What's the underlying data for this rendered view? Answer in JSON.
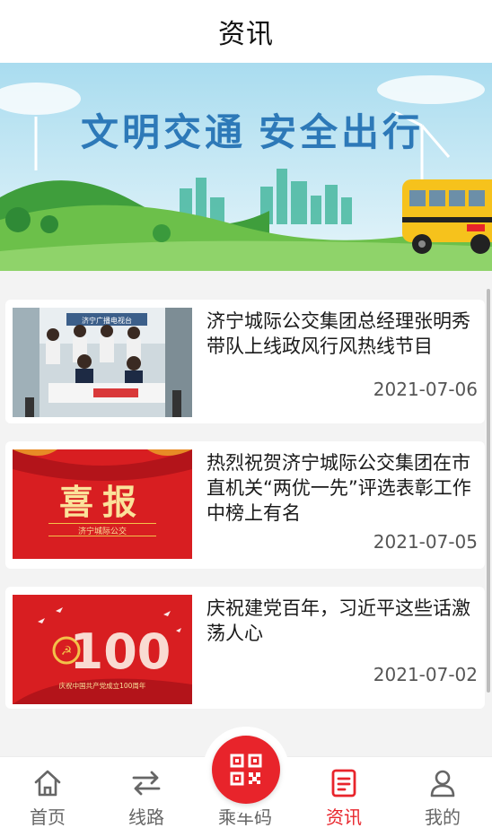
{
  "header": {
    "title": "资讯"
  },
  "banner": {
    "slogan_left": "文明交通",
    "slogan_right": "安全出行"
  },
  "news": [
    {
      "title": "济宁城际公交集团总经理张明秀带队上线政风行风热线节目",
      "date": "2021-07-06",
      "thumb": "studio-photo-icon",
      "thumb_caption": "济宁广播电视台"
    },
    {
      "title": "热烈祝贺济宁城际公交集团在市直机关“两优一先”评选表彰工作中榜上有名",
      "date": "2021-07-05",
      "thumb": "xibao-poster-icon",
      "thumb_big": "喜报",
      "thumb_caption": "济宁城际公交"
    },
    {
      "title": "庆祝建党百年，习近平这些话激荡人心",
      "date": "2021-07-02",
      "thumb": "party-100-poster-icon",
      "thumb_caption": "庆祝中国共产党成立100周年"
    }
  ],
  "tabbar": {
    "items": [
      {
        "label": "首页",
        "icon": "home-icon"
      },
      {
        "label": "线路",
        "icon": "route-arrows-icon"
      },
      {
        "label": "乘车码",
        "icon": "qr-code-icon"
      },
      {
        "label": "资讯",
        "icon": "news-icon"
      },
      {
        "label": "我的",
        "icon": "user-icon"
      }
    ],
    "active_index": 3
  },
  "colors": {
    "accent": "#e8242b",
    "sky": "#bfe6f3",
    "grass": "#6cc04a"
  }
}
